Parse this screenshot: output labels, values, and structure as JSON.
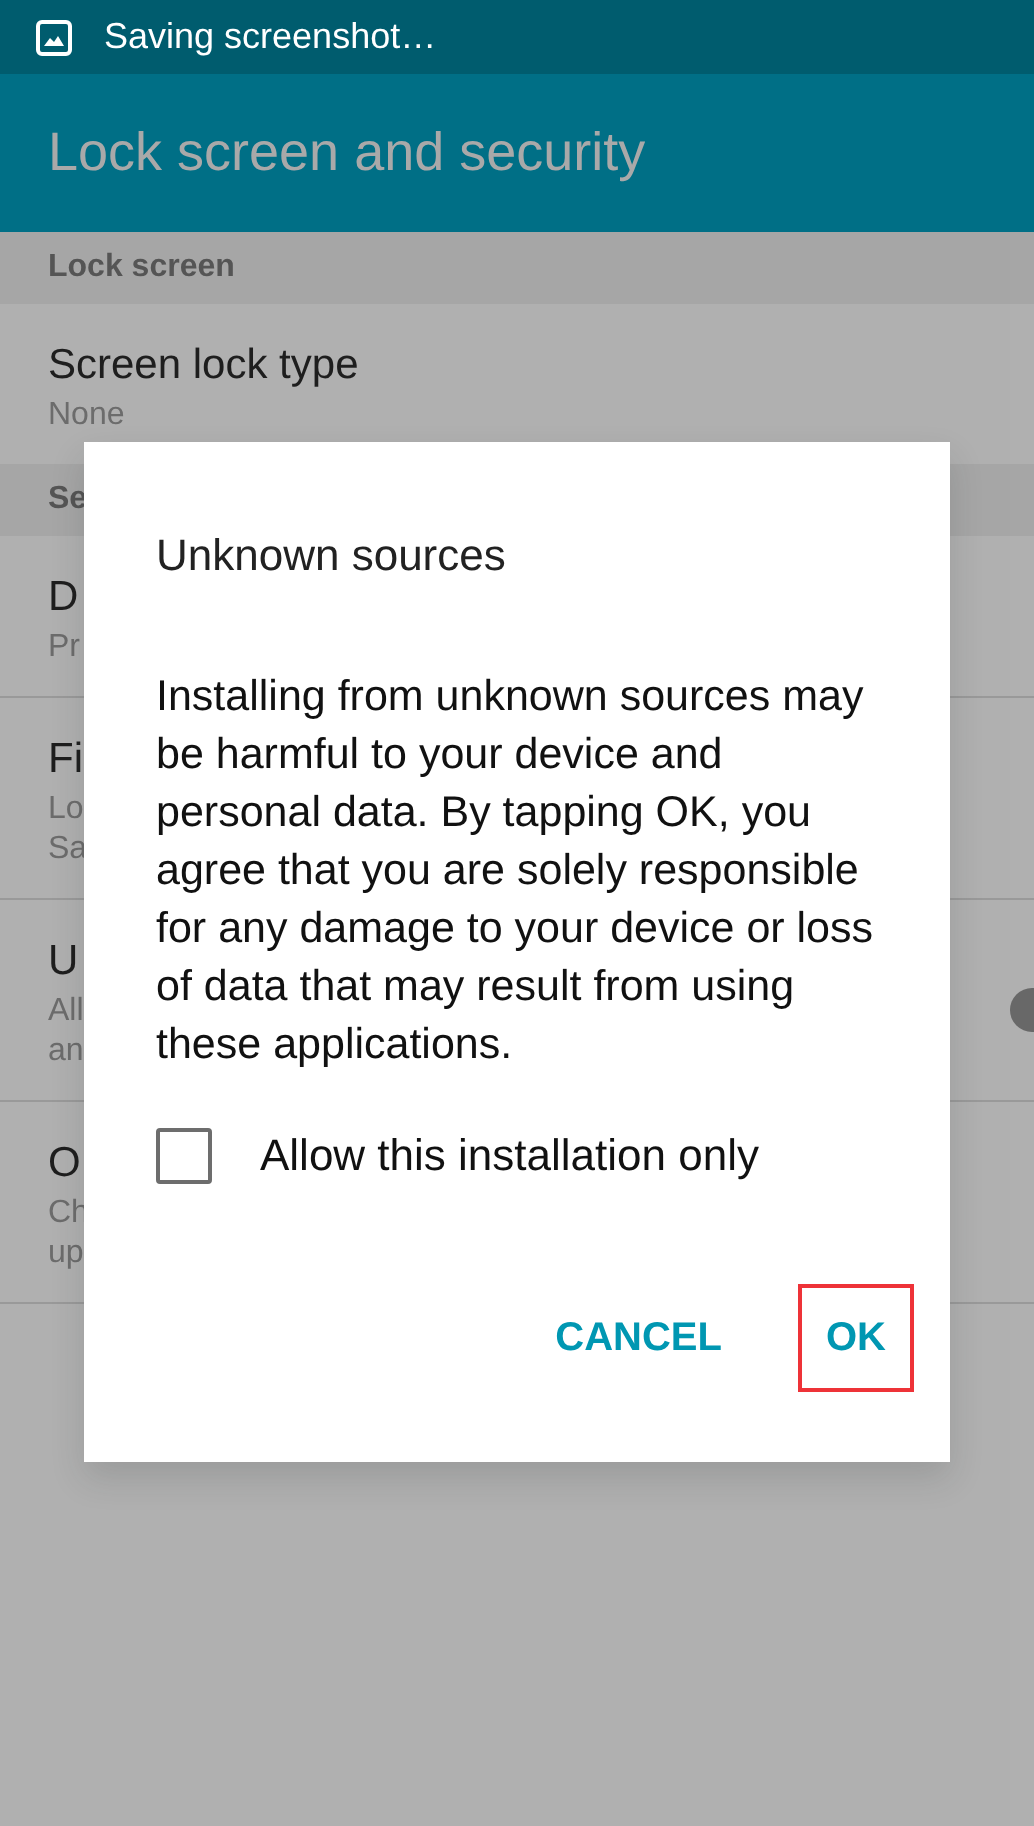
{
  "status_bar": {
    "notification": "Saving screenshot…"
  },
  "header": {
    "title": "Lock screen and security"
  },
  "list": [
    {
      "kind": "section",
      "title": "Lock screen"
    },
    {
      "kind": "item",
      "title": "Screen lock type",
      "summary": [
        "None"
      ]
    },
    {
      "kind": "section",
      "title": "Se"
    },
    {
      "kind": "item",
      "title": "D",
      "summary": [
        "Pr"
      ]
    },
    {
      "kind": "item",
      "title": "Fi",
      "summary": [
        "Lo",
        "Sa"
      ]
    },
    {
      "kind": "item",
      "title": "U",
      "summary": [
        "All",
        "an"
      ],
      "switch": {
        "on": false
      }
    },
    {
      "kind": "item",
      "title": "O",
      "summary": [
        "Ch",
        "up"
      ]
    }
  ],
  "dialog": {
    "title": "Unknown sources",
    "message": "Installing from unknown sources may be harmful to your device and personal data. By tapping OK, you agree that you are solely responsible for any damage to your device or loss of data that may result from using these applications.",
    "checkbox": {
      "label": "Allow this installation only",
      "checked": false
    },
    "buttons": [
      {
        "label": "CANCEL",
        "highlighted": false
      },
      {
        "label": "OK",
        "highlighted": true
      }
    ]
  }
}
